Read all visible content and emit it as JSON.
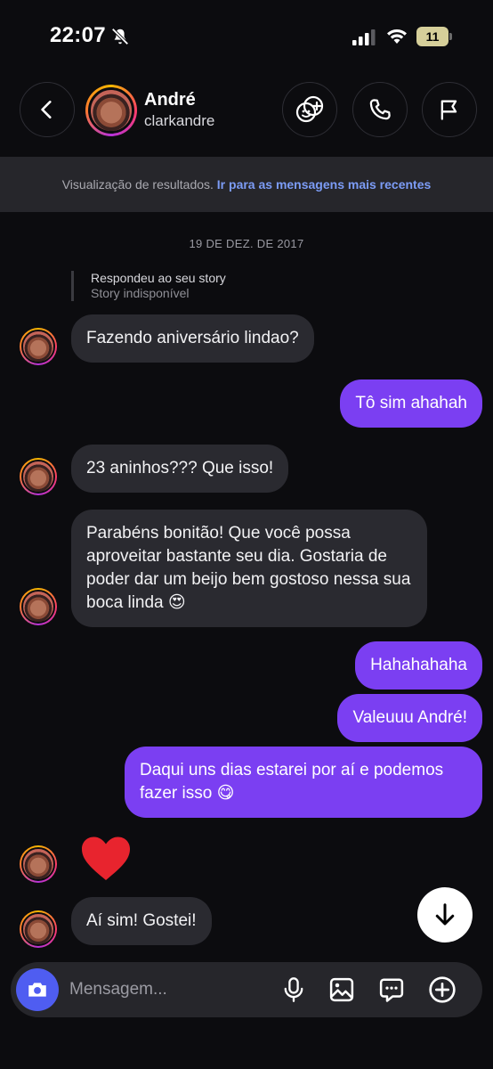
{
  "status_bar": {
    "time": "22:07",
    "battery": "11"
  },
  "header": {
    "name": "André",
    "username": "clarkandre"
  },
  "banner": {
    "text": "Visualização de resultados.",
    "link": "Ir para as mensagens mais recentes"
  },
  "chat": {
    "date": "19 DE DEZ. DE 2017",
    "reply_title": "Respondeu ao seu story",
    "reply_sub": "Story indisponível",
    "messages": [
      "Fazendo aniversário lindao?",
      "Tô sim ahahah",
      "23 aninhos??? Que isso!",
      "Parabéns bonitão! Que você possa aproveitar bastante seu dia. Gostaria de poder dar um beijo bem gostoso nessa sua boca linda 😍",
      "Hahahahaha",
      "Valeuuu André!",
      "Daqui uns dias estarei por aí e podemos fazer isso 😋",
      "Aí sim! Gostei!"
    ]
  },
  "composer": {
    "placeholder": "Mensagem..."
  },
  "colors": {
    "outgoing": "#7b3ff2",
    "incoming": "#2a2a30",
    "link": "#7c9cf6",
    "camera": "#4f5df1",
    "heart": "#e8242e"
  }
}
